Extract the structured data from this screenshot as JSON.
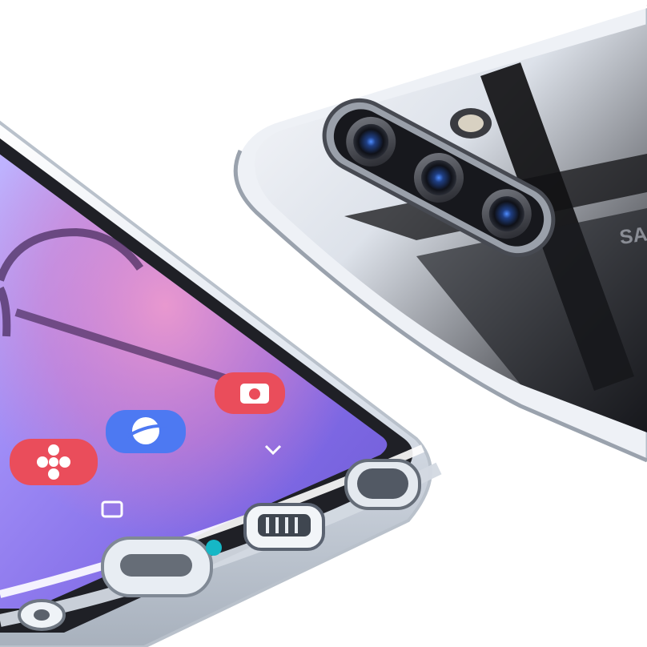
{
  "scene": {
    "back_logo_text": "SA",
    "colors": {
      "background": "#ffffff",
      "screen_purple": "#8f7cf0",
      "screen_pink": "#e97ab8",
      "case_clear": "#f4f7fb",
      "frame_dark": "#1e1e24",
      "icon_red": "#ea4d5b",
      "icon_blue": "#4d79f2",
      "camera_blue": "#4e8cff",
      "mic_teal": "#16b7c6"
    },
    "front_phone": {
      "app_icons": [
        "camera-app-icon",
        "internet-app-icon",
        "gallery-app-icon"
      ],
      "nav_buttons": [
        "recent-apps-button",
        "back-button"
      ]
    },
    "back_phone": {
      "cameras": [
        "camera-lens-top",
        "camera-lens-middle",
        "camera-lens-bottom"
      ]
    }
  }
}
